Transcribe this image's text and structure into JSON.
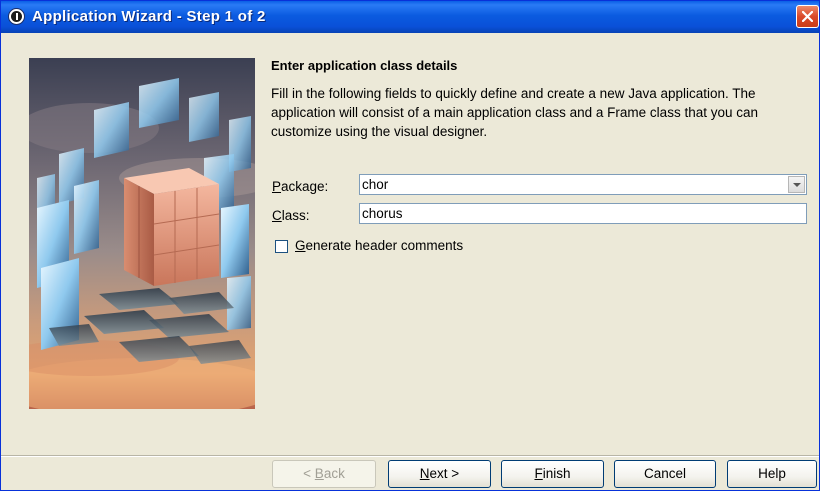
{
  "window": {
    "title": "Application Wizard - Step 1 of 2"
  },
  "content": {
    "heading": "Enter application class details",
    "description": "Fill in the following fields to quickly define and create a new Java application. The application will consist of a main application class and a Frame class that you can customize using the visual designer."
  },
  "form": {
    "package_label_mnemonic": "P",
    "package_label_rest": "ackage:",
    "package_value": "chor",
    "class_label_mnemonic": "C",
    "class_label_rest": "lass:",
    "class_value": "chorus",
    "generate_mnemonic": "G",
    "generate_rest": "enerate header comments",
    "generate_checked": false
  },
  "buttons": {
    "back_prefix": "< ",
    "back_mnemonic": "B",
    "back_rest": "ack",
    "next_mnemonic": "N",
    "next_rest": "ext >",
    "finish_mnemonic": "F",
    "finish_rest": "inish",
    "cancel": "Cancel",
    "help": "Help"
  },
  "icons": {
    "app": "jdeveloper-app-icon",
    "close": "close-icon",
    "combo": "chevron-down-icon"
  },
  "colors": {
    "titlebar": "#0A5FE6",
    "close_button": "#DA4A2A",
    "dialog_background": "#ECE9D8"
  }
}
